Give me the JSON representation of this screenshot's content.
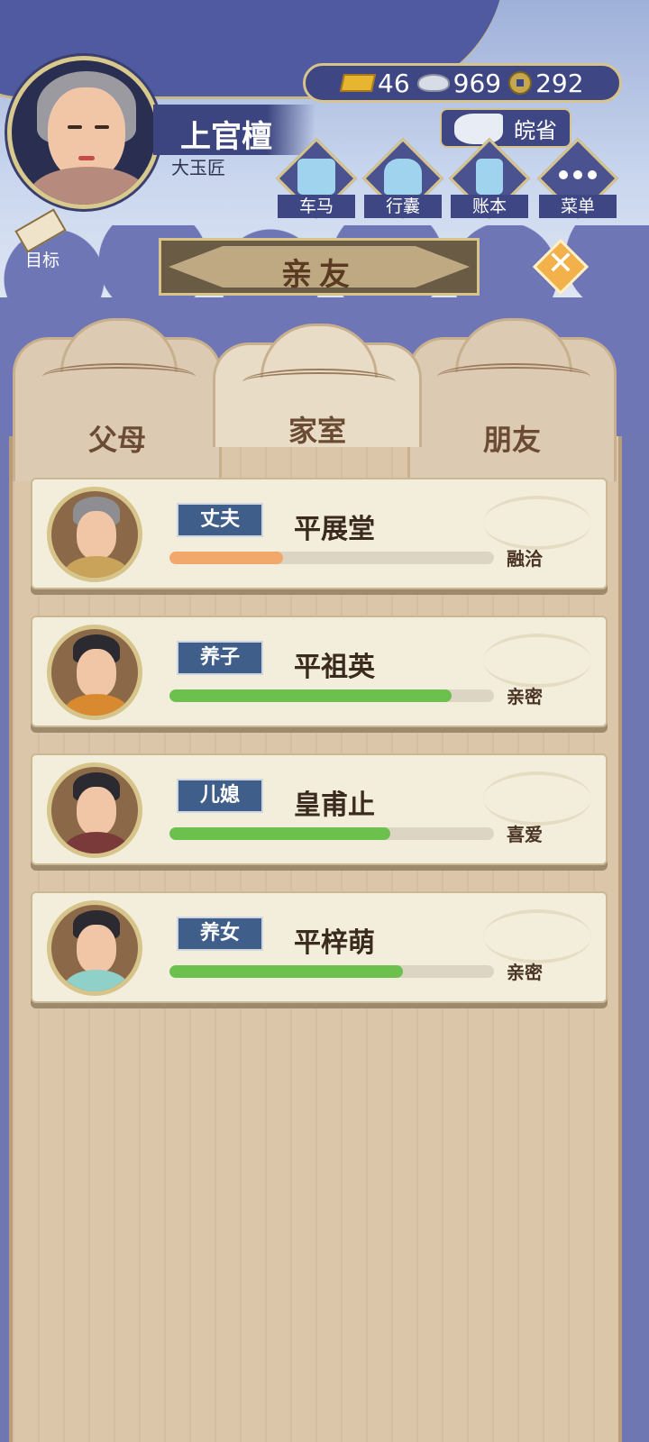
{
  "player": {
    "name": "上官檀",
    "title": "大玉匠"
  },
  "currency": {
    "gold": "46",
    "silver": "969",
    "coins": "292"
  },
  "region": "皖省",
  "actions": [
    {
      "label": "车马",
      "icon": "carriage-icon"
    },
    {
      "label": "行囊",
      "icon": "bag-icon"
    },
    {
      "label": "账本",
      "icon": "ledger-icon"
    },
    {
      "label": "菜单",
      "icon": "menu-dots-icon"
    }
  ],
  "goal_label": "目标",
  "page_title": "亲友",
  "tabs": [
    {
      "label": "父母",
      "active": false
    },
    {
      "label": "家室",
      "active": true
    },
    {
      "label": "朋友",
      "active": false
    }
  ],
  "relatives": [
    {
      "role": "丈夫",
      "name": "平展堂",
      "status": "融洽",
      "affinity": 0.35,
      "bar_color": "#f2a86a",
      "robe_color": "#c9a35a"
    },
    {
      "role": "养子",
      "name": "平祖英",
      "status": "亲密",
      "affinity": 0.87,
      "bar_color": "#6cc04e",
      "robe_color": "#d98a30"
    },
    {
      "role": "儿媳",
      "name": "皇甫止",
      "status": "喜爱",
      "affinity": 0.68,
      "bar_color": "#6cc04e",
      "robe_color": "#7a3a3a"
    },
    {
      "role": "养女",
      "name": "平梓萌",
      "status": "亲密",
      "affinity": 0.72,
      "bar_color": "#6cc04e",
      "robe_color": "#8fd0c8"
    }
  ]
}
